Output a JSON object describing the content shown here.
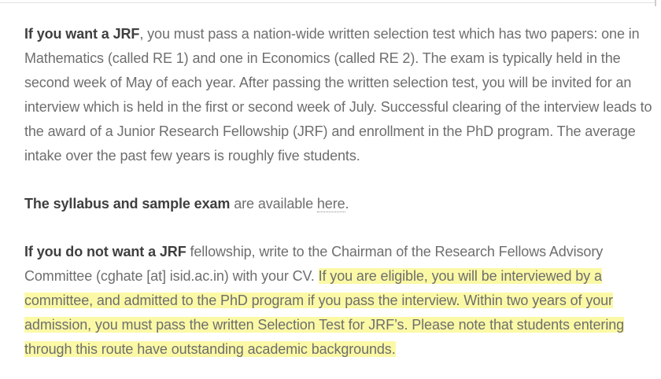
{
  "jrf": {
    "lead": "If you want a JRF",
    "body": ", you must pass a nation-wide written selection test which has two papers: one in Mathematics (called RE 1) and one in Economics (called RE 2). The exam is typically held in the second week of May of each year. After passing the written selection test, you will be invited for an interview which is held in the first or second week of July. Successful clearing of the interview leads to the award of a Junior Research Fellowship (JRF) and enrollment in the PhD program. The average intake over the past few years is roughly five students."
  },
  "syllabus": {
    "lead": "The syllabus and sample exam",
    "body": " are available ",
    "link_text": "here",
    "tail": "."
  },
  "no_jrf": {
    "lead": "If you do not want a JRF",
    "body": " fellowship, write to the Chairman of the Research Fellows Advisory Committee (cghate [at] isid.ac.in) with your CV. ",
    "highlight": "If you are eligible, you will be interviewed by a committee, and admitted to the PhD program if you pass the interview. Within two years of your admission, you must pass the written Selection Test for JRF’s. Please note that students entering through this route have outstanding academic backgrounds."
  },
  "colors": {
    "highlight": "#fbf9a6",
    "body_text": "#6e6e6e",
    "strong_text": "#3f3f3f"
  }
}
